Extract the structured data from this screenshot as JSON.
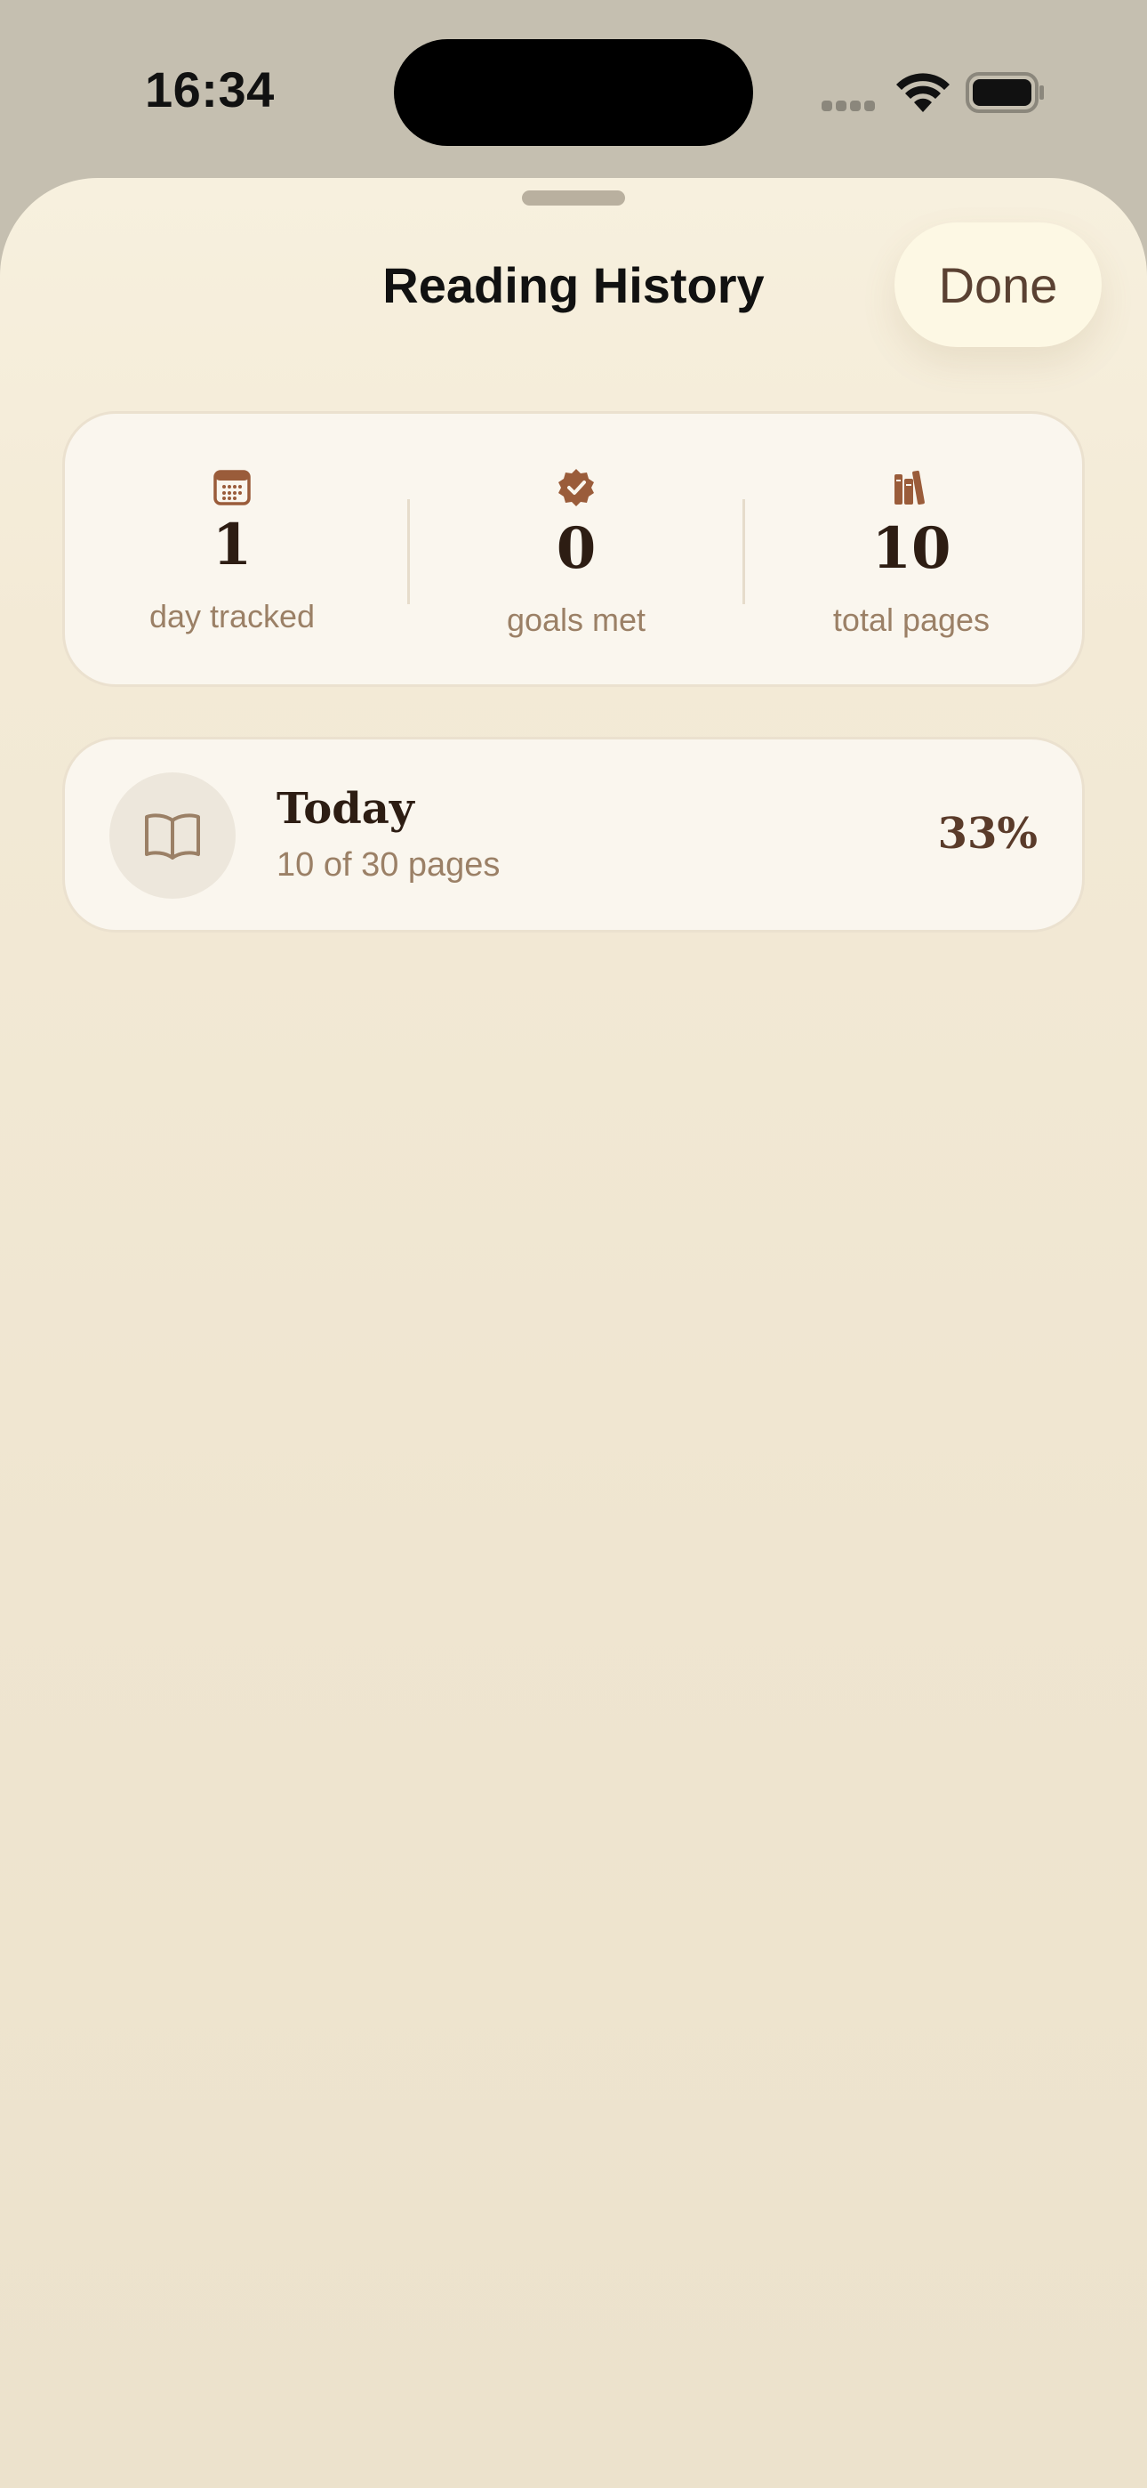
{
  "status_bar": {
    "time": "16:34"
  },
  "sheet": {
    "title": "Reading History",
    "done_label": "Done"
  },
  "stats": [
    {
      "icon": "calendar-icon",
      "value": "1",
      "label": "day tracked"
    },
    {
      "icon": "checkmark-seal-icon",
      "value": "0",
      "label": "goals met"
    },
    {
      "icon": "books-icon",
      "value": "10",
      "label": "total pages"
    }
  ],
  "history": [
    {
      "icon": "book-open-icon",
      "title": "Today",
      "subtitle": "10 of 30 pages",
      "percent": "33%"
    }
  ],
  "colors": {
    "accent": "#9a5c3a",
    "text_primary": "#2d1d13",
    "text_secondary": "#9b8066",
    "sheet_background": "#f3ead6",
    "card_background": "#faf6ee"
  }
}
